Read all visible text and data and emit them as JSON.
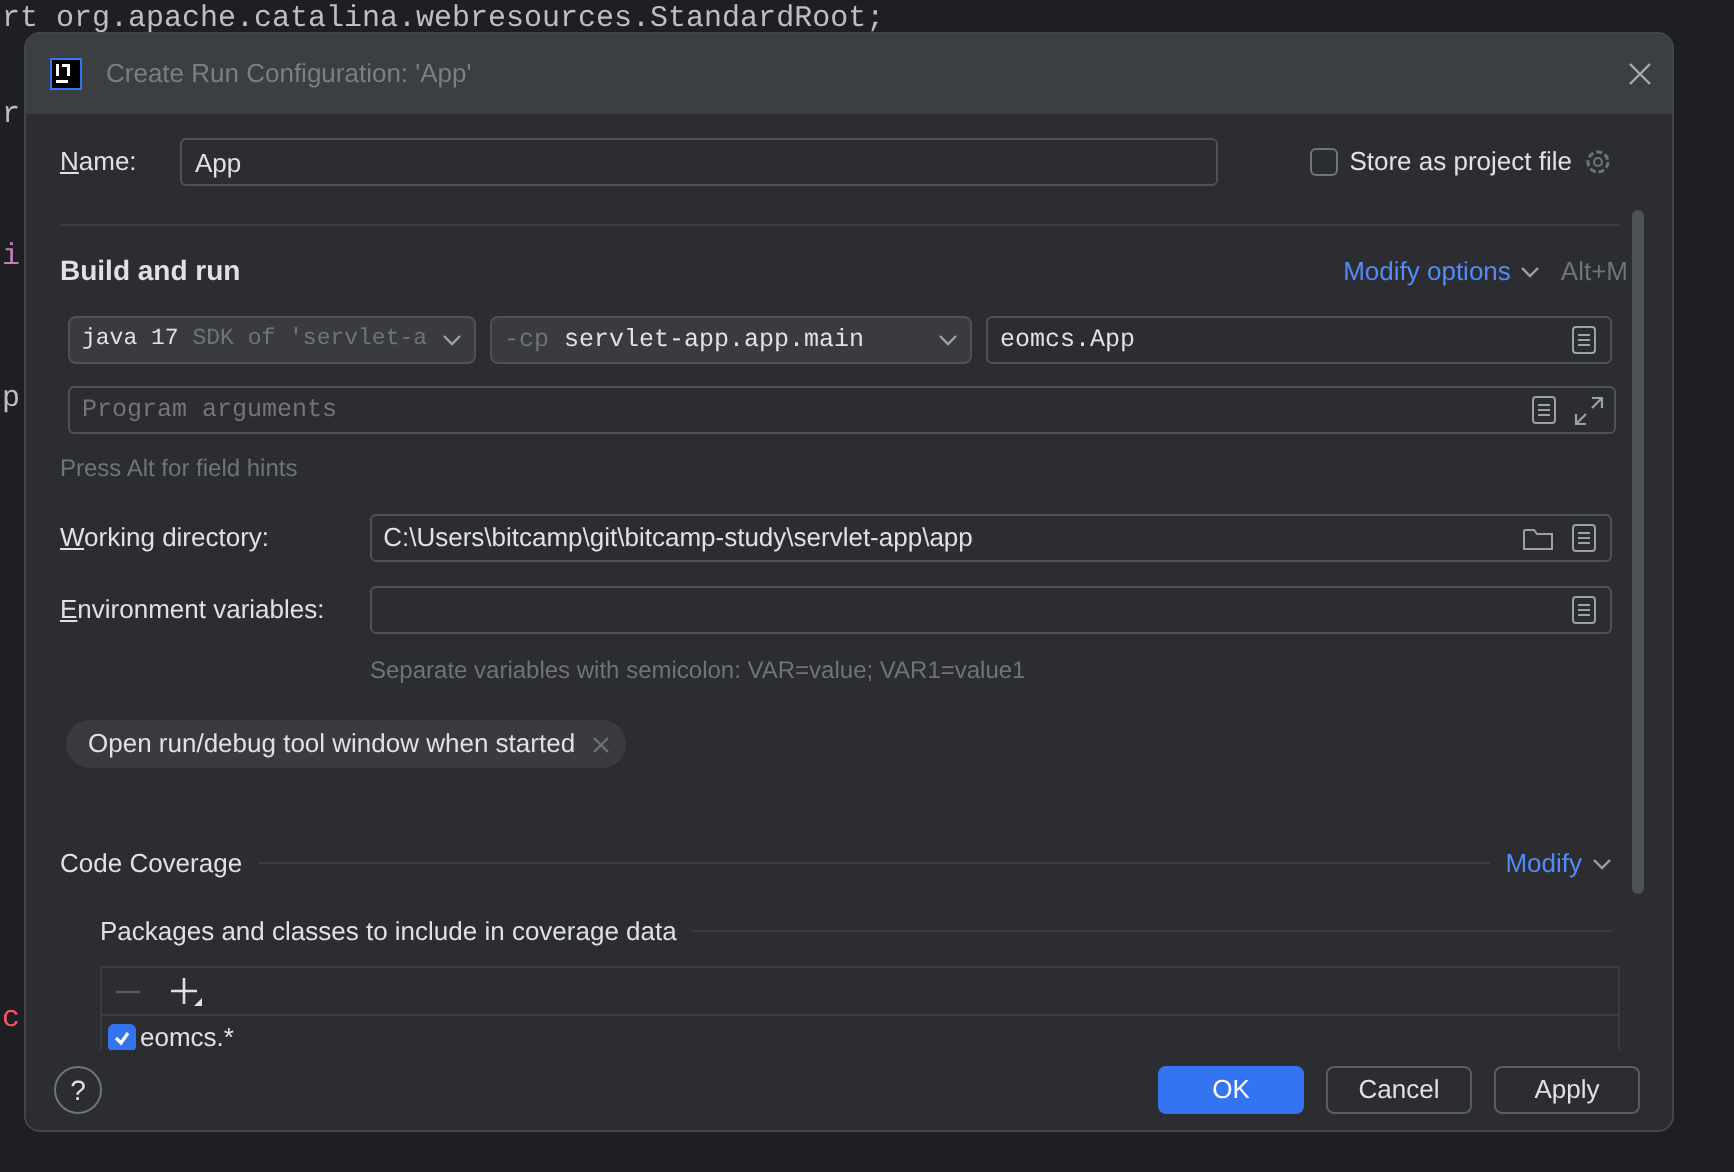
{
  "editor_lines": [
    "rt org.apache.catalina.webresources.StandardRoot;",
    "r",
    "i",
    "p",
    "c"
  ],
  "dialog": {
    "title": "Create Run Configuration: 'App'"
  },
  "name": {
    "label": "Name:",
    "value": "App"
  },
  "store_as_project_file": {
    "label": "Store as project file",
    "checked": false
  },
  "build_and_run": {
    "title": "Build and run",
    "modify_link": "Modify options",
    "shortcut": "Alt+M",
    "jre": {
      "value": "java 17",
      "hint": "SDK of 'servlet-a"
    },
    "classpath": {
      "prefix": "-cp",
      "value": "servlet-app.app.main"
    },
    "main_class": {
      "value": "eomcs.App"
    },
    "program_arguments": {
      "placeholder": "Program arguments"
    },
    "field_hint": "Press Alt for field hints"
  },
  "working_directory": {
    "label": "Working directory:",
    "value": "C:\\Users\\bitcamp\\git\\bitcamp-study\\servlet-app\\app"
  },
  "environment_variables": {
    "label": "Environment variables:",
    "hint": "Separate variables with semicolon: VAR=value; VAR1=value1"
  },
  "options": [
    {
      "label": "Open run/debug tool window when started"
    }
  ],
  "code_coverage": {
    "title": "Code Coverage",
    "modify_link": "Modify",
    "packages_title": "Packages and classes to include in coverage data",
    "patterns": [
      {
        "label": "eomcs.*",
        "checked": true
      }
    ]
  },
  "help": "?",
  "buttons": [
    {
      "label": "OK",
      "kind": "primary"
    },
    {
      "label": "Cancel",
      "kind": "secondary"
    },
    {
      "label": "Apply",
      "kind": "secondary"
    }
  ]
}
